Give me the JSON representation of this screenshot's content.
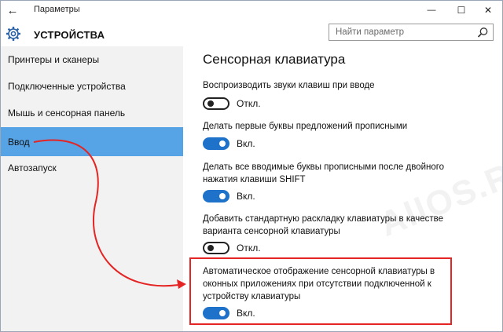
{
  "window": {
    "title": "Параметры",
    "controls": {
      "minimize": "—",
      "maximize": "☐",
      "close": "✕"
    }
  },
  "header": {
    "section_title": "УСТРОЙСТВА",
    "search_placeholder": "Найти параметр"
  },
  "sidebar": {
    "items": [
      {
        "label": "Принтеры и сканеры"
      },
      {
        "label": "Подключенные устройства"
      },
      {
        "label": "Мышь и сенсорная панель"
      },
      {
        "label": "Ввод"
      },
      {
        "label": "Автозапуск"
      }
    ],
    "active_index": 3
  },
  "main": {
    "title": "Сенсорная клавиатура",
    "options": [
      {
        "label_lines": [
          "Воспроизводить звуки клавиш при вводе"
        ],
        "state": "off",
        "state_label": "Откл."
      },
      {
        "label_lines": [
          "Делать первые буквы предложений прописными"
        ],
        "state": "on",
        "state_label": "Вкл."
      },
      {
        "label_lines": [
          "Делать все вводимые буквы прописными после двойного",
          "нажатия клавиши SHIFT"
        ],
        "state": "on",
        "state_label": "Вкл."
      },
      {
        "label_lines": [
          "Добавить стандартную раскладку клавиатуры в качестве",
          "варианта сенсорной клавиатуры"
        ],
        "state": "off",
        "state_label": "Откл."
      },
      {
        "label_lines": [
          "Автоматическое отображение сенсорной клавиатуры в",
          "оконных приложениях при отсутствии подключенной к",
          "устройству клавиатуры"
        ],
        "state": "on",
        "state_label": "Вкл."
      }
    ]
  },
  "watermark": "AllOS.RU",
  "colors": {
    "accent": "#1f72c9",
    "sidebar_active": "#56a3e6",
    "sidebar_bg": "#f2f2f2",
    "highlight": "#e52424"
  }
}
